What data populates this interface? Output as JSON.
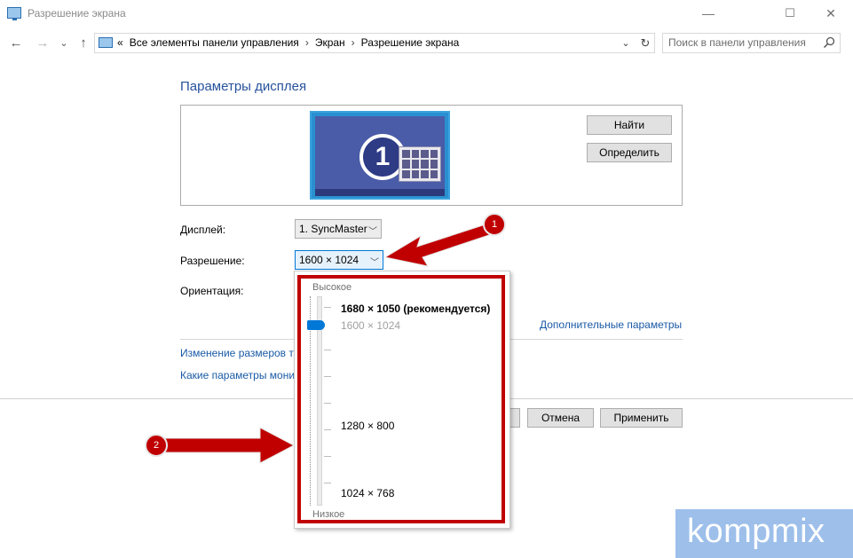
{
  "window": {
    "title": "Разрешение экрана",
    "controls": {
      "minimize": "—",
      "maximize": "☐",
      "close": "✕"
    }
  },
  "nav": {
    "back": "←",
    "forward": "→",
    "recent": "⌄",
    "up": "↑"
  },
  "address": {
    "overflow": "«",
    "crumbs": [
      "Все элементы панели управления",
      "Экран",
      "Разрешение экрана"
    ],
    "separator": "›",
    "dropdown_glyph": "⌄",
    "refresh_glyph": "↻"
  },
  "search": {
    "placeholder": "Поиск в панели управления"
  },
  "main": {
    "heading": "Параметры дисплея",
    "monitor_number": "1",
    "find_button": "Найти",
    "identify_button": "Определить",
    "display_label": "Дисплей:",
    "display_value": "1. SyncMaster",
    "resolution_label": "Разрешение:",
    "resolution_value": "1600 × 1024",
    "orientation_label": "Ориентация:",
    "advanced_link": "Дополнительные параметры",
    "resize_link": "Изменение размеров те",
    "which_link": "Какие параметры мони",
    "cancel_button": "Отмена",
    "apply_button": "Применить"
  },
  "dropdown": {
    "high_label": "Высокое",
    "low_label": "Низкое",
    "options": [
      {
        "label": "1680 × 1050 (рекомендуется)",
        "style": "bold"
      },
      {
        "label": "1600 × 1024",
        "style": "selected-gray"
      },
      {
        "label": "1280 × 800",
        "style": "normal"
      },
      {
        "label": "1024 × 768",
        "style": "normal"
      }
    ]
  },
  "annotations": {
    "badge_1": "1",
    "badge_2": "2"
  },
  "watermark": {
    "text": "kompmix"
  },
  "colors": {
    "accent": "#0078d7",
    "link": "#1a5aa6",
    "heading": "#26519b",
    "annotation_red": "#c00000"
  }
}
